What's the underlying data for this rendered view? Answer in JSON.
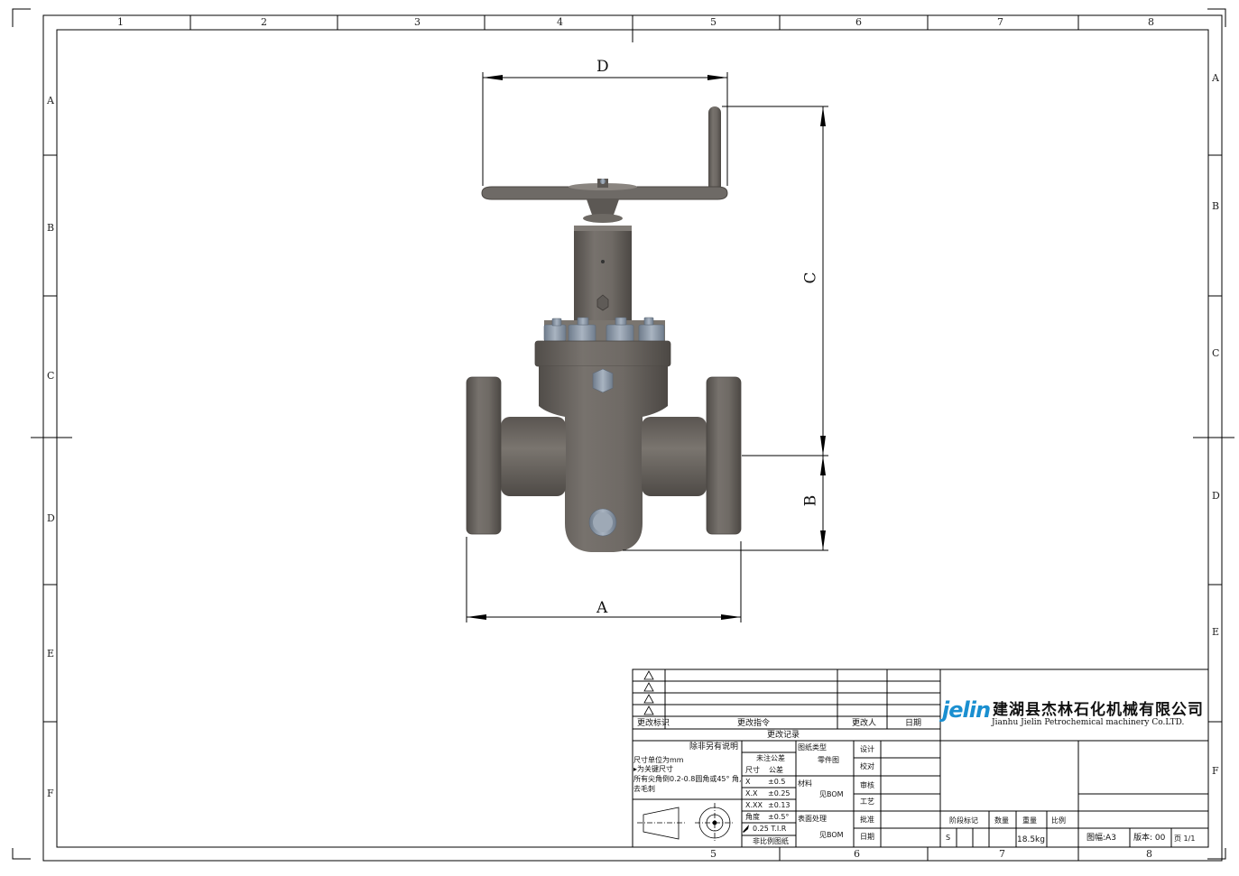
{
  "zones": {
    "top_cols": [
      "1",
      "2",
      "3",
      "4",
      "5",
      "6",
      "7",
      "8"
    ],
    "bottom_cols": [
      "5",
      "6",
      "7",
      "8"
    ],
    "rows": [
      "A",
      "B",
      "C",
      "D",
      "E",
      "F"
    ]
  },
  "dimensions": {
    "a": "A",
    "b": "B",
    "c": "C",
    "d": "D"
  },
  "company": {
    "logo": "jelin",
    "name_cn": "建湖县杰林石化机械有限公司",
    "name_en": "Jianhu Jielin Petrochemical machinery Co.LTD."
  },
  "revision": {
    "col_mark": "更改标识",
    "col_order": "更改指令",
    "col_person": "更改人",
    "col_date": "日期",
    "title": "更改记录"
  },
  "notes": {
    "heading": "除非另有说明",
    "lines": [
      "尺寸单位为mm",
      "▸为关键尺寸",
      "所有尖角倒0.2-0.8圆角或45° 角,",
      "去毛刺"
    ]
  },
  "tolerance": {
    "heading": "未注公差",
    "col1": "尺寸",
    "col2": "公差",
    "rows": [
      {
        "k": "X",
        "v": "±0.5"
      },
      {
        "k": "X.X",
        "v": "±0.25"
      },
      {
        "k": "X.XX",
        "v": "±0.13"
      },
      {
        "k": "角度",
        "v": "±0.5°"
      },
      {
        "k": "0.25 T.I.R",
        "v": ""
      }
    ],
    "not_scale": "非比例图纸"
  },
  "drawing_info": {
    "type_label": "图纸类型",
    "type_value": "零件图",
    "material_label": "材料",
    "material_value": "见BOM",
    "surface_label": "表面处理",
    "surface_value": "见BOM"
  },
  "sign": [
    "设计",
    "校对",
    "审核",
    "工艺",
    "批准",
    "日期"
  ],
  "stage": {
    "stage_label": "阶段标记",
    "qty_label": "数量",
    "weight_label": "重量",
    "scale_label": "比例",
    "stage_value": "S",
    "weight_value": "18.5kg",
    "sheet_size": "图幅:A3",
    "version": "版本: 00",
    "page": "页 1/1"
  },
  "colors": {
    "body": "#6e6a66",
    "body_dark": "#4f4b47",
    "bolt": "#8c99a8",
    "line": "#000000",
    "logo": "#1a8fd0"
  }
}
